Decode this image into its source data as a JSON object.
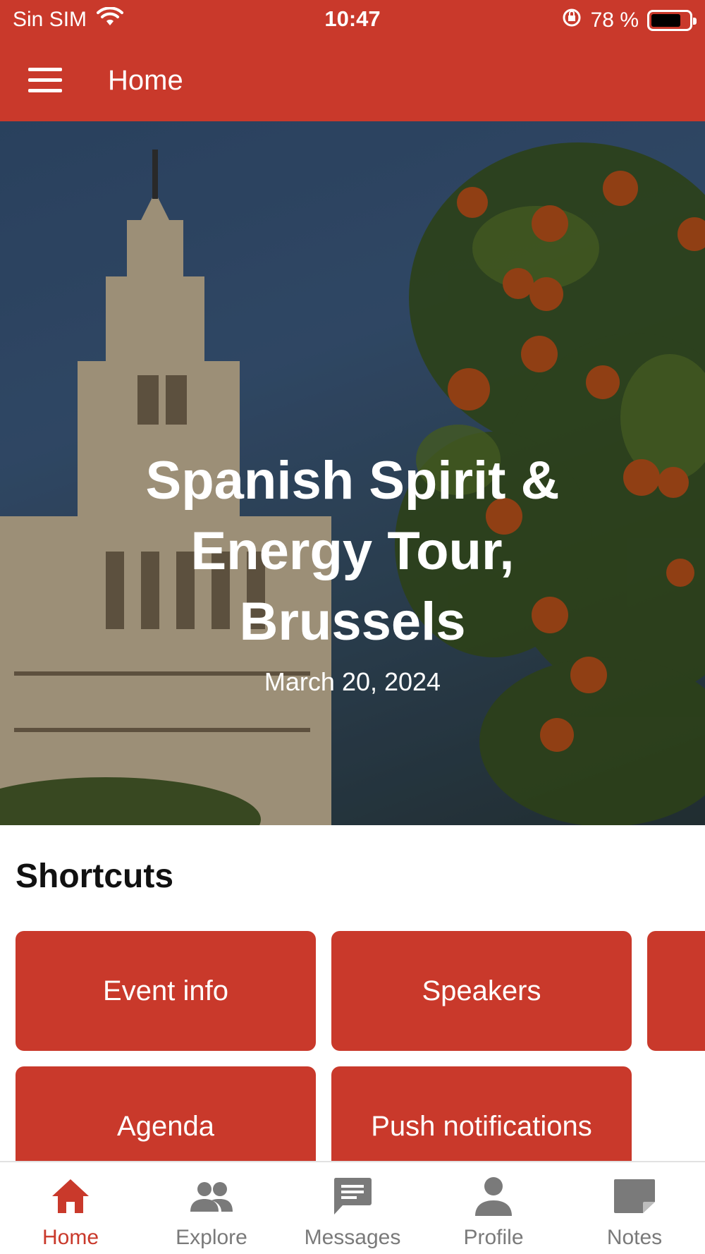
{
  "status_bar": {
    "carrier": "Sin SIM",
    "time": "10:47",
    "battery_text": "78 %",
    "battery_level": 0.78
  },
  "header": {
    "title": "Home"
  },
  "hero": {
    "title": "Spanish Spirit & Energy Tour, Brussels",
    "date": "March 20, 2024"
  },
  "shortcuts": {
    "title": "Shortcuts",
    "items": [
      {
        "label": "Event info"
      },
      {
        "label": "Speakers"
      },
      {
        "label": ""
      },
      {
        "label": "Agenda"
      },
      {
        "label": "Push notifications"
      }
    ]
  },
  "bottom_nav": {
    "items": [
      {
        "label": "Home",
        "icon": "home-icon",
        "active": true
      },
      {
        "label": "Explore",
        "icon": "people-icon",
        "active": false
      },
      {
        "label": "Messages",
        "icon": "chat-icon",
        "active": false
      },
      {
        "label": "Profile",
        "icon": "person-icon",
        "active": false
      },
      {
        "label": "Notes",
        "icon": "note-icon",
        "active": false
      }
    ]
  },
  "colors": {
    "primary": "#c9392b",
    "inactive": "#7a7a7a"
  }
}
